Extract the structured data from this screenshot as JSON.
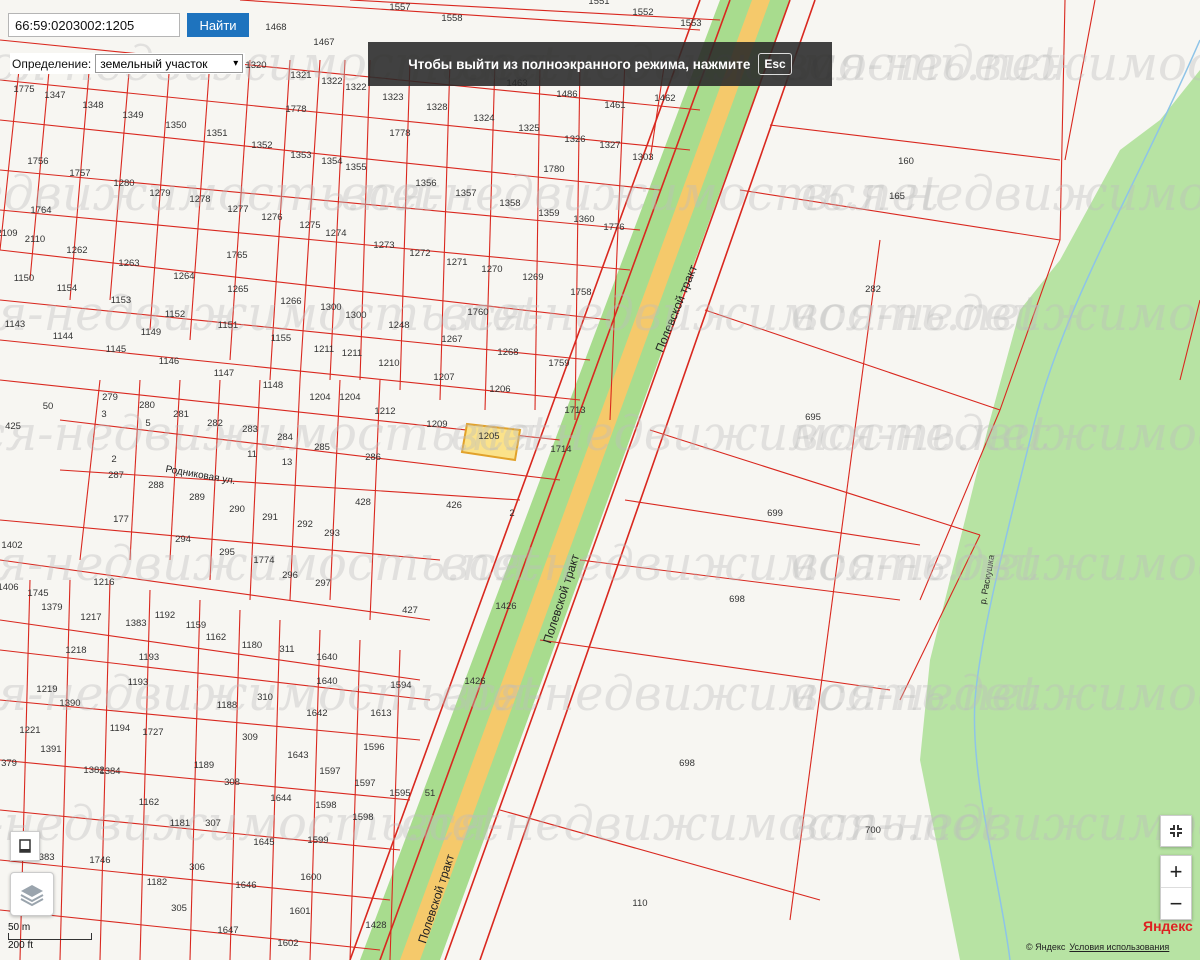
{
  "search": {
    "value": "66:59:0203002:1205",
    "button_label": "Найти"
  },
  "definition": {
    "label": "Определение:",
    "selected": "земельный участок"
  },
  "fullscreen_notice": {
    "text": "Чтобы выйти из полноэкранного режима, нажмите",
    "key": "Esc"
  },
  "watermark": "вся-недвижимость.net",
  "selected_parcel": "1205",
  "colors": {
    "parcel_line": "#d9281f",
    "selected_fill": "#fbe28a",
    "forest": "#b7e3a3",
    "road_green": "#a8dc8e",
    "road_center": "#f5c96b",
    "button_blue": "#1e73be"
  },
  "roads": {
    "highway": "Полевской тракт",
    "street_rodnik": "Родниковая ул.",
    "river": "р. Раскушка"
  },
  "parcel_labels": [
    [
      "1557",
      400,
      10
    ],
    [
      "1558",
      452,
      21
    ],
    [
      "1551",
      599,
      4
    ],
    [
      "1552",
      643,
      15
    ],
    [
      "1553",
      691,
      26
    ],
    [
      "1468",
      276,
      30
    ],
    [
      "1467",
      324,
      45
    ],
    [
      "1320",
      256,
      68
    ],
    [
      "1321",
      301,
      78
    ],
    [
      "1322",
      332,
      84
    ],
    [
      "1322",
      356,
      90
    ],
    [
      "1323",
      393,
      100
    ],
    [
      "1328",
      437,
      110
    ],
    [
      "1324",
      484,
      121
    ],
    [
      "1325",
      529,
      131
    ],
    [
      "1326",
      575,
      142
    ],
    [
      "1327",
      610,
      148
    ],
    [
      "1303",
      643,
      160
    ],
    [
      "1486",
      567,
      97
    ],
    [
      "1461",
      615,
      108
    ],
    [
      "1462",
      665,
      101
    ],
    [
      "1463",
      517,
      86
    ],
    [
      "1775",
      24,
      92
    ],
    [
      "1347",
      55,
      98
    ],
    [
      "1348",
      93,
      108
    ],
    [
      "1349",
      133,
      118
    ],
    [
      "1350",
      176,
      128
    ],
    [
      "1351",
      217,
      136
    ],
    [
      "1352",
      262,
      148
    ],
    [
      "1353",
      301,
      158
    ],
    [
      "1354",
      332,
      164
    ],
    [
      "1355",
      356,
      170
    ],
    [
      "1778",
      296,
      112
    ],
    [
      "1778",
      400,
      136
    ],
    [
      "1780",
      554,
      172
    ],
    [
      "1756",
      38,
      164
    ],
    [
      "1757",
      80,
      176
    ],
    [
      "1280",
      124,
      186
    ],
    [
      "1279",
      160,
      196
    ],
    [
      "1278",
      200,
      202
    ],
    [
      "1277",
      238,
      212
    ],
    [
      "1276",
      272,
      220
    ],
    [
      "1275",
      310,
      228
    ],
    [
      "1274",
      336,
      236
    ],
    [
      "1273",
      384,
      248
    ],
    [
      "1272",
      420,
      256
    ],
    [
      "1356",
      426,
      186
    ],
    [
      "1357",
      466,
      196
    ],
    [
      "1358",
      510,
      206
    ],
    [
      "1359",
      549,
      216
    ],
    [
      "1360",
      584,
      222
    ],
    [
      "1776",
      614,
      230
    ],
    [
      "1271",
      457,
      265
    ],
    [
      "1270",
      492,
      272
    ],
    [
      "1269",
      533,
      280
    ],
    [
      "1758",
      581,
      295
    ],
    [
      "1764",
      41,
      213
    ],
    [
      "2109",
      7,
      236
    ],
    [
      "2110",
      35,
      242
    ],
    [
      "1262",
      77,
      253
    ],
    [
      "1263",
      129,
      266
    ],
    [
      "1264",
      184,
      279
    ],
    [
      "1765",
      237,
      258
    ],
    [
      "1265",
      238,
      292
    ],
    [
      "1266",
      291,
      304
    ],
    [
      "1300",
      331,
      310
    ],
    [
      "1300",
      356,
      318
    ],
    [
      "1248",
      399,
      328
    ],
    [
      "1760",
      478,
      315
    ],
    [
      "1267",
      452,
      342
    ],
    [
      "1268",
      508,
      355
    ],
    [
      "1759",
      559,
      366
    ],
    [
      "1150",
      24,
      281
    ],
    [
      "1154",
      67,
      291
    ],
    [
      "1153",
      121,
      303
    ],
    [
      "1152",
      175,
      317
    ],
    [
      "1151",
      228,
      328
    ],
    [
      "1155",
      281,
      341
    ],
    [
      "1143",
      15,
      327
    ],
    [
      "1144",
      63,
      339
    ],
    [
      "1149",
      151,
      335
    ],
    [
      "1145",
      116,
      352
    ],
    [
      "1211",
      324,
      352
    ],
    [
      "1211",
      352,
      356
    ],
    [
      "1210",
      389,
      366
    ],
    [
      "1207",
      444,
      380
    ],
    [
      "1206",
      500,
      392
    ],
    [
      "1146",
      169,
      364
    ],
    [
      "1147",
      224,
      376
    ],
    [
      "1148",
      273,
      388
    ],
    [
      "1204",
      320,
      400
    ],
    [
      "1204",
      350,
      400
    ],
    [
      "1212",
      385,
      414
    ],
    [
      "1209",
      437,
      427
    ],
    [
      "1205",
      489,
      439
    ],
    [
      "1713",
      575,
      413
    ],
    [
      "1714",
      561,
      452
    ],
    [
      "425",
      13,
      429
    ],
    [
      "50",
      48,
      409
    ],
    [
      "279",
      110,
      400
    ],
    [
      "280",
      147,
      408
    ],
    [
      "281",
      181,
      417
    ],
    [
      "282",
      215,
      426
    ],
    [
      "283",
      250,
      432
    ],
    [
      "284",
      285,
      440
    ],
    [
      "285",
      322,
      450
    ],
    [
      "286",
      373,
      460
    ],
    [
      "287",
      116,
      478
    ],
    [
      "288",
      156,
      488
    ],
    [
      "289",
      197,
      500
    ],
    [
      "290",
      237,
      512
    ],
    [
      "291",
      270,
      520
    ],
    [
      "292",
      305,
      527
    ],
    [
      "293",
      332,
      536
    ],
    [
      "294",
      183,
      542
    ],
    [
      "295",
      227,
      555
    ],
    [
      "1774",
      264,
      563
    ],
    [
      "296",
      290,
      578
    ],
    [
      "297",
      323,
      586
    ],
    [
      "177",
      121,
      522
    ],
    [
      "428",
      363,
      505
    ],
    [
      "426",
      454,
      508
    ],
    [
      "1402",
      12,
      548
    ],
    [
      "1406",
      8,
      590
    ],
    [
      "1745",
      38,
      596
    ],
    [
      "1216",
      104,
      585
    ],
    [
      "1217",
      91,
      620
    ],
    [
      "1379",
      52,
      610
    ],
    [
      "1218",
      76,
      653
    ],
    [
      "1383",
      136,
      626
    ],
    [
      "1192",
      165,
      618
    ],
    [
      "1193",
      149,
      660
    ],
    [
      "1159",
      196,
      628
    ],
    [
      "1193",
      138,
      685
    ],
    [
      "1162",
      216,
      640
    ],
    [
      "1180",
      252,
      648
    ],
    [
      "311",
      287,
      652
    ],
    [
      "427",
      410,
      613
    ],
    [
      "1426",
      506,
      609
    ],
    [
      "1640",
      327,
      660
    ],
    [
      "1640",
      327,
      684
    ],
    [
      "1594",
      401,
      688
    ],
    [
      "1426",
      475,
      684
    ],
    [
      "1219",
      47,
      692
    ],
    [
      "1390",
      70,
      706
    ],
    [
      "1221",
      30,
      733
    ],
    [
      "1391",
      51,
      752
    ],
    [
      "1194",
      120,
      731
    ],
    [
      "1727",
      153,
      735
    ],
    [
      "1188",
      227,
      708
    ],
    [
      "310",
      265,
      700
    ],
    [
      "309",
      250,
      740
    ],
    [
      "1189",
      204,
      768
    ],
    [
      "1642",
      317,
      716
    ],
    [
      "1613",
      381,
      716
    ],
    [
      "1596",
      374,
      750
    ],
    [
      "1643",
      298,
      758
    ],
    [
      "1597",
      330,
      774
    ],
    [
      "1597",
      365,
      786
    ],
    [
      "379",
      9,
      766
    ],
    [
      "1382",
      94,
      773
    ],
    [
      "1384",
      110,
      774
    ],
    [
      "308",
      232,
      785
    ],
    [
      "1595",
      400,
      796
    ],
    [
      "51",
      430,
      796
    ],
    [
      "1162",
      149,
      805
    ],
    [
      "1181",
      180,
      826
    ],
    [
      "307",
      213,
      826
    ],
    [
      "1644",
      281,
      801
    ],
    [
      "1598",
      326,
      808
    ],
    [
      "1598",
      363,
      820
    ],
    [
      "1599",
      318,
      843
    ],
    [
      "1645",
      264,
      845
    ],
    [
      "1746",
      100,
      863
    ],
    [
      "1383",
      44,
      860
    ],
    [
      "306",
      197,
      870
    ],
    [
      "1600",
      311,
      880
    ],
    [
      "1182",
      157,
      885
    ],
    [
      "305",
      179,
      911
    ],
    [
      "1646",
      246,
      888
    ],
    [
      "1601",
      300,
      914
    ],
    [
      "1647",
      228,
      933
    ],
    [
      "1602",
      288,
      946
    ],
    [
      "1428",
      376,
      928
    ],
    [
      "160",
      906,
      164
    ],
    [
      "165",
      897,
      199
    ],
    [
      "282",
      873,
      292
    ],
    [
      "695",
      813,
      420
    ],
    [
      "699",
      775,
      516
    ],
    [
      "698",
      737,
      602
    ],
    [
      "698",
      687,
      766
    ],
    [
      "700",
      873,
      833
    ],
    [
      "110",
      640,
      906
    ],
    [
      "2",
      512,
      516
    ],
    [
      "11",
      252,
      457
    ],
    [
      "13",
      287,
      465
    ],
    [
      "5",
      148,
      426
    ],
    [
      "3",
      104,
      417
    ],
    [
      "2",
      114,
      462
    ]
  ]
}
